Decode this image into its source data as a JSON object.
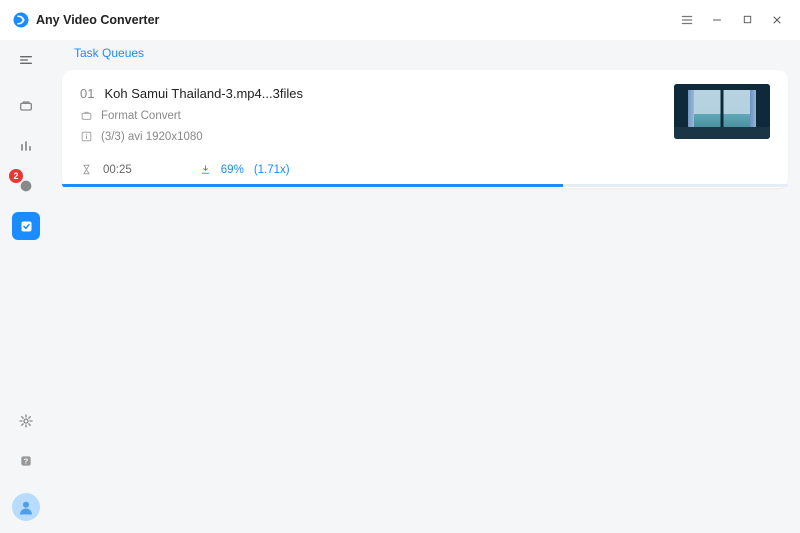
{
  "app": {
    "title": "Any Video Converter"
  },
  "window": {
    "menu": "Menu",
    "minimize": "Minimize",
    "maximize": "Maximize",
    "close": "Close"
  },
  "tabs": {
    "task_queues": "Task Queues"
  },
  "sidebar": {
    "hamburger": "Toggle",
    "convert": "Convert",
    "tools": "Tools",
    "downloads": {
      "label": "Downloads",
      "badge": "2"
    },
    "task_queue": "Task Queue",
    "settings": "Settings",
    "help": "Help",
    "account": "Account"
  },
  "task": {
    "index": "01",
    "filename": "Koh Samui Thailand-3.mp4...3files",
    "type_icon": "briefcase-icon",
    "type_label": "Format Convert",
    "info_icon": "info-icon",
    "info_label": "(3/3) avi 1920x1080",
    "time_icon": "hourglass-icon",
    "elapsed": "00:25",
    "percent": "69%",
    "speed": "(1.71x)",
    "progress_pct": 69
  }
}
